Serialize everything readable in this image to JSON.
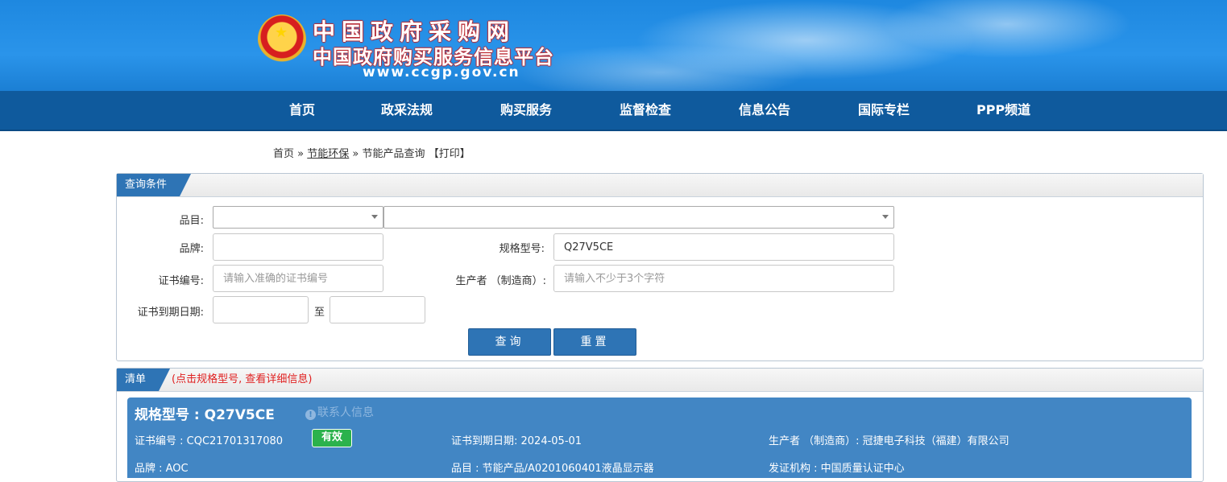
{
  "banner": {
    "title": "中国政府采购网",
    "subtitle": "中国政府购买服务信息平台",
    "url": "www.ccgp.gov.cn"
  },
  "nav": [
    "首页",
    "政采法规",
    "购买服务",
    "监督检查",
    "信息公告",
    "国际专栏",
    "PPP频道"
  ],
  "breadcrumb": {
    "home": "首页",
    "sep": "»",
    "section": "节能环保",
    "current": "节能产品查询",
    "print": "【打印】"
  },
  "query": {
    "tab_label": "查询条件",
    "category_label": "品目:",
    "brand_label": "品牌:",
    "brand_value": "",
    "model_label": "规格型号:",
    "model_value": "Q27V5CE",
    "cert_label": "证书编号:",
    "cert_placeholder": "请输入准确的证书编号",
    "maker_label": "生产者 （制造商）:",
    "maker_placeholder": "请输入不少于3个字符",
    "expiry_label": "证书到期日期:",
    "to_label": "至",
    "search_button": "查询",
    "reset_button": "重置"
  },
  "results": {
    "tab_label": "清单",
    "hint": "(点击规格型号, 查看详细信息)",
    "items": [
      {
        "model_title": "规格型号 : Q27V5CE",
        "contact": "联系人信息",
        "cert_no": "证书编号 : CQC21701317080",
        "status": "有效",
        "expiry": "证书到期日期: 2024-05-01",
        "maker": "生产者 （制造商）: 冠捷电子科技（福建）有限公司",
        "brand": "品牌 : AOC",
        "category": "品目 : 节能产品/A0201060401液晶显示器",
        "issuer": "发证机构 : 中国质量认证中心"
      }
    ]
  },
  "colors": {
    "nav_bg": "#0f5a9d",
    "accent": "#2e74b5",
    "card_bg": "#4286c4",
    "status_green": "#2bb24c",
    "hint_red": "#e02020"
  }
}
